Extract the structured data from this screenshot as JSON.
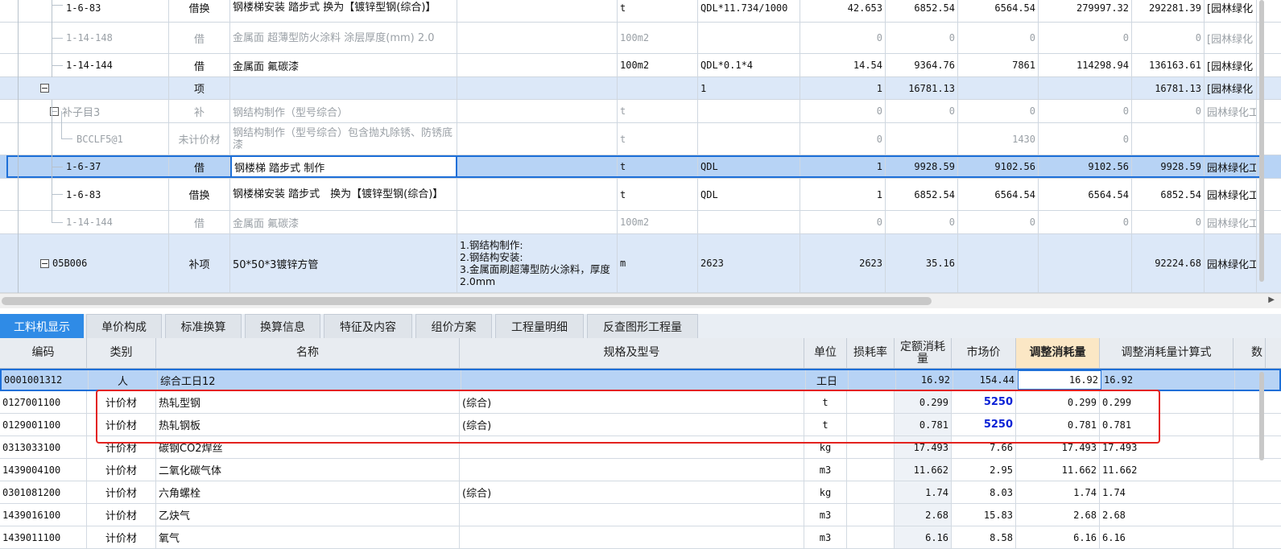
{
  "upper_rows": [
    {
      "code": "1-6-83",
      "type": "借换",
      "name": "钢楼梯安装 踏步式 换为【镀锌型钢(综合)】",
      "feature": "",
      "unit": "t",
      "expr": "QDL*11.734/1000",
      "qty": "42.653",
      "price1": "6852.54",
      "price2": "6564.54",
      "total1": "279997.32",
      "total2": "292281.39",
      "prof": "[园林绿化"
    },
    {
      "code": "1-14-148",
      "type": "借",
      "name": "金属面 超薄型防火涂料 涂层厚度(mm) 2.0",
      "feature": "",
      "unit": "100m2",
      "expr": "",
      "qty": "0",
      "price1": "0",
      "price2": "0",
      "total1": "0",
      "total2": "0",
      "prof": "[园林绿化"
    },
    {
      "code": "1-14-144",
      "type": "借",
      "name": "金属面 氟碳漆",
      "feature": "",
      "unit": "100m2",
      "expr": "QDL*0.1*4",
      "qty": "14.54",
      "price1": "9364.76",
      "price2": "7861",
      "total1": "114298.94",
      "total2": "136163.61",
      "prof": "[园林绿化"
    },
    {
      "code": "",
      "type": "项",
      "name": "",
      "feature": "",
      "unit": "",
      "expr": "1",
      "qty": "1",
      "price1": "16781.13",
      "price2": "",
      "total1": "",
      "total2": "16781.13",
      "prof": "[园林绿化"
    },
    {
      "code": "补子目3",
      "type": "补",
      "name": "钢结构制作（型号综合）",
      "feature": "",
      "unit": "t",
      "expr": "",
      "qty": "0",
      "price1": "0",
      "price2": "0",
      "total1": "0",
      "total2": "0",
      "prof": "园林绿化工"
    },
    {
      "code": "BCCLF5@1",
      "type": "未计价材",
      "name": "钢结构制作（型号综合）包含抛丸除锈、防锈底漆",
      "feature": "",
      "unit": "t",
      "expr": "",
      "qty": "0",
      "price1": "",
      "price2": "1430",
      "total1": "0",
      "total2": "",
      "prof": ""
    },
    {
      "code": "1-6-37",
      "type": "借",
      "name": "钢楼梯 踏步式 制作",
      "feature": "",
      "unit": "t",
      "expr": "QDL",
      "qty": "1",
      "price1": "9928.59",
      "price2": "9102.56",
      "total1": "9102.56",
      "total2": "9928.59",
      "prof": "园林绿化工"
    },
    {
      "code": "1-6-83",
      "type": "借换",
      "name": "钢楼梯安装 踏步式　换为【镀锌型钢(综合)】",
      "feature": "",
      "unit": "t",
      "expr": "QDL",
      "qty": "1",
      "price1": "6852.54",
      "price2": "6564.54",
      "total1": "6564.54",
      "total2": "6852.54",
      "prof": "园林绿化工"
    },
    {
      "code": "1-14-144",
      "type": "借",
      "name": "金属面 氟碳漆",
      "feature": "",
      "unit": "100m2",
      "expr": "",
      "qty": "0",
      "price1": "0",
      "price2": "0",
      "total1": "0",
      "total2": "0",
      "prof": "园林绿化工"
    },
    {
      "code": "05B006",
      "type": "补项",
      "name": "50*50*3镀锌方管",
      "feature": "1.钢结构制作:\n2.钢结构安装:\n3.金属面刷超薄型防火涂料，厚度2.0mm",
      "unit": "m",
      "expr": "2623",
      "qty": "2623",
      "price1": "35.16",
      "price2": "",
      "total1": "",
      "total2": "92224.68",
      "prof": "园林绿化工"
    }
  ],
  "tabs": [
    "工料机显示",
    "单价构成",
    "标准换算",
    "换算信息",
    "特征及内容",
    "组价方案",
    "工程量明细",
    "反查图形工程量"
  ],
  "lower_headers": {
    "code": "编码",
    "type": "类别",
    "name": "名称",
    "spec": "规格及型号",
    "unit": "单位",
    "loss": "损耗率",
    "quota": "定额消耗量",
    "market": "市场价",
    "adjust": "调整消耗量",
    "formula": "调整消耗量计算式",
    "extra": "数"
  },
  "lower_rows": [
    {
      "code": "0001001312",
      "type": "人",
      "name": "综合工日12",
      "spec": "",
      "unit": "工日",
      "loss": "",
      "quota": "16.92",
      "market": "154.44",
      "adjust": "16.92",
      "formula": "16.92"
    },
    {
      "code": "0127001100",
      "type": "计价材",
      "name": "热轧型钢",
      "spec": "(综合)",
      "unit": "t",
      "loss": "",
      "quota": "0.299",
      "market": "5250",
      "adjust": "0.299",
      "formula": "0.299"
    },
    {
      "code": "0129001100",
      "type": "计价材",
      "name": "热轧钢板",
      "spec": "(综合)",
      "unit": "t",
      "loss": "",
      "quota": "0.781",
      "market": "5250",
      "adjust": "0.781",
      "formula": "0.781"
    },
    {
      "code": "0313033100",
      "type": "计价材",
      "name": "碳钢CO2焊丝",
      "spec": "",
      "unit": "kg",
      "loss": "",
      "quota": "17.493",
      "market": "7.66",
      "adjust": "17.493",
      "formula": "17.493"
    },
    {
      "code": "1439004100",
      "type": "计价材",
      "name": "二氧化碳气体",
      "spec": "",
      "unit": "m3",
      "loss": "",
      "quota": "11.662",
      "market": "2.95",
      "adjust": "11.662",
      "formula": "11.662"
    },
    {
      "code": "0301081200",
      "type": "计价材",
      "name": "六角螺栓",
      "spec": "(综合)",
      "unit": "kg",
      "loss": "",
      "quota": "1.74",
      "market": "8.03",
      "adjust": "1.74",
      "formula": "1.74"
    },
    {
      "code": "1439016100",
      "type": "计价材",
      "name": "乙炔气",
      "spec": "",
      "unit": "m3",
      "loss": "",
      "quota": "2.68",
      "market": "15.83",
      "adjust": "2.68",
      "formula": "2.68"
    },
    {
      "code": "1439011100",
      "type": "计价材",
      "name": "氧气",
      "spec": "",
      "unit": "m3",
      "loss": "",
      "quota": "6.16",
      "market": "8.58",
      "adjust": "6.16",
      "formula": "6.16"
    }
  ]
}
